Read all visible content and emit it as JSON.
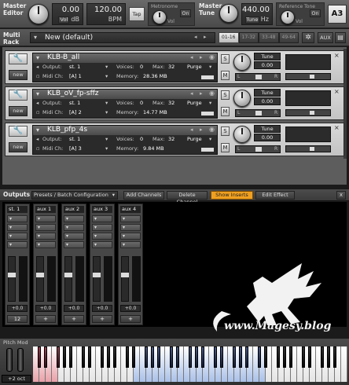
{
  "top": {
    "master_editor": "Master Editor",
    "volume_value": "0.00",
    "volume_unit": "dB",
    "vol_btn": "Vol",
    "tempo_value": "120.00",
    "tempo_unit": "BPM",
    "tap_btn": "Tap",
    "metronome_label": "Metronome",
    "metronome_vol": "Vol",
    "on_btn": "On",
    "master_tune": "Master Tune",
    "tune_value": "440.00",
    "tune_btn": "Tune",
    "tune_unit": "Hz",
    "reference_tone": "Reference Tone",
    "ref_vol": "Vol",
    "ref_on": "On",
    "ref_note": "A3"
  },
  "rack": {
    "label": "Multi Rack",
    "preset": "New (default)",
    "pages": [
      "01-16",
      "17-32",
      "33-48",
      "49-64"
    ],
    "aux": "AUX"
  },
  "instruments": [
    {
      "name": "KLB-B_all",
      "output": "st. 1",
      "midi": "[A] 1",
      "voices_label": "Voices:",
      "voices": "0",
      "max_label": "Max:",
      "max": "32",
      "purge": "Purge",
      "memory_label": "Memory:",
      "memory": "28.36 MB",
      "output_label": "Output:",
      "midi_label": "Midi Ch:"
    },
    {
      "name": "KLB_oV_fp-sffz",
      "output": "st. 1",
      "midi": "[A] 2",
      "voices_label": "Voices:",
      "voices": "0",
      "max_label": "Max:",
      "max": "32",
      "purge": "Purge",
      "memory_label": "Memory:",
      "memory": "14.77 MB",
      "output_label": "Output:",
      "midi_label": "Midi Ch:"
    },
    {
      "name": "KLB_pfp_4s",
      "output": "st. 1",
      "midi": "[A] 3",
      "voices_label": "Voices:",
      "voices": "0",
      "max_label": "Max:",
      "max": "32",
      "purge": "Purge",
      "memory_label": "Memory:",
      "memory": "9.84 MB",
      "output_label": "Output:",
      "midi_label": "Midi Ch:"
    }
  ],
  "inst_ui": {
    "tune_label": "Tune",
    "tune_value": "0.00",
    "s_btn": "S",
    "m_btn": "M",
    "l_label": "L",
    "r_label": "R",
    "new_label": "new"
  },
  "outputs": {
    "label": "Outputs",
    "presets": "Presets / Batch Configuration",
    "add_channels": "Add Channels",
    "delete_channel": "Delete Channel",
    "show_inserts": "Show Inserts",
    "edit_effect": "Edit Effect",
    "close": "x",
    "channels": [
      {
        "name": "st. 1",
        "db": "+0.0",
        "foot": "12"
      },
      {
        "name": "aux 1",
        "db": "+0.0",
        "foot": "+"
      },
      {
        "name": "aux 2",
        "db": "+0.0",
        "foot": "+"
      },
      {
        "name": "aux 3",
        "db": "+0.0",
        "foot": "+"
      },
      {
        "name": "aux 4",
        "db": "+0.0",
        "foot": "+"
      }
    ]
  },
  "watermark": "www.Magesy.blog",
  "keyboard": {
    "pitch_mod": "Pitch Mod",
    "octave": "+2 oct"
  },
  "colors": {
    "orange": "#f0a020",
    "keyzone_blue": "#a9c0e8",
    "keyzone_red": "#e8a0a8"
  }
}
